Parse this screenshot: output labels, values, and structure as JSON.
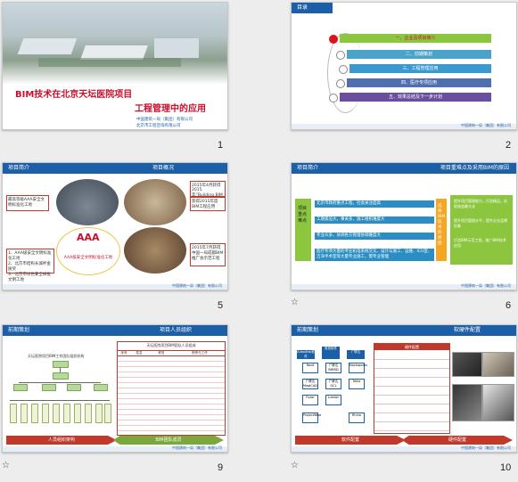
{
  "slides": [
    {
      "number": "1",
      "title_line1": "BIM技术在北京天坛医院项目",
      "title_line2": "工程管理中的应用",
      "company1": "中国建筑一局（集团）有限公司",
      "company2": "北京市工程咨询有限公司"
    },
    {
      "number": "2",
      "header": "目录",
      "menu": [
        {
          "label": "一、企业及项目简介",
          "color": "#8cc63f"
        },
        {
          "label": "二、前期策划",
          "color": "#4aa3c8"
        },
        {
          "label": "三、工程管理应用",
          "color": "#3a9ad0"
        },
        {
          "label": "四、医疗专项应用",
          "color": "#4f6fae"
        },
        {
          "label": "五、效果总结及下一步计划",
          "color": "#6a4f9e"
        }
      ]
    },
    {
      "number": "5",
      "header": "项目简介",
      "header_right": "项目概况",
      "box_left_top": "最高等级AAA安全文明标准化工地",
      "box_left_list": [
        "1、AAA级安全文明标准化工地",
        "2、北京市结构长城杯金质奖",
        "3、北京市绿色安全样板文明工地"
      ],
      "box_right_top": "2015年4月获得2015年“Building BIM奖”",
      "box_right_mid": "获得2015年度BIM工程应用",
      "box_right_bottom": "2015年7月获得中国一局成都BIM推广会示范工程",
      "aaa_text": "AAA",
      "aaa_sub": "AAA级安全文明标准化工地"
    },
    {
      "number": "6",
      "header": "项目简介",
      "header_right": "项目重难点及采用BIM的原因",
      "left_label": "项目重点难点",
      "right_label": "选择BIM技术的原因",
      "rows": [
        "北京市政府重点工程，社会关注度高",
        "工期紧迫大，事关多，施工组织难度大",
        "专业众多，协调各方管理协调难度大",
        "医疗专项大量的专业机电系统交叉、设计与施工、运维、ICU室、洁净手术室等大量专业施工，需专业管理"
      ],
      "right_texts": [
        "提升项目管理能力，打造精品，实现效益最大化",
        "提升项目管理水平，提升企业品牌形象",
        "打造BIM示范工程，推广BIM技术应用"
      ]
    },
    {
      "number": "9",
      "header": "前期策划",
      "header_right": "项目人员组织",
      "org_title": "天坛医院项目BIM工作团队组织机构",
      "table_title": "天坛医院项目BIM团队人员组成",
      "table_cols": [
        "序号",
        "姓名",
        "职务",
        "职责与工作"
      ],
      "bottom_left": "人员组织架构",
      "bottom_right": "BIM团队成员"
    },
    {
      "number": "10",
      "header": "前期策划",
      "header_right": "软硬件配置",
      "software_top": [
        "Autodesk软件",
        "鲁班软件",
        "广联达"
      ],
      "software_cells": [
        "Revit",
        "广联达BIM5D",
        "Navisworks",
        "广联达MagiCAD",
        "广联达GCL",
        "Tekla",
        "Fuzor",
        "Lumion",
        "ProjectWise",
        "Rhino"
      ],
      "table_title": "硬件配置",
      "bottom_left": "软件配置",
      "bottom_right": "硬件配置"
    }
  ]
}
